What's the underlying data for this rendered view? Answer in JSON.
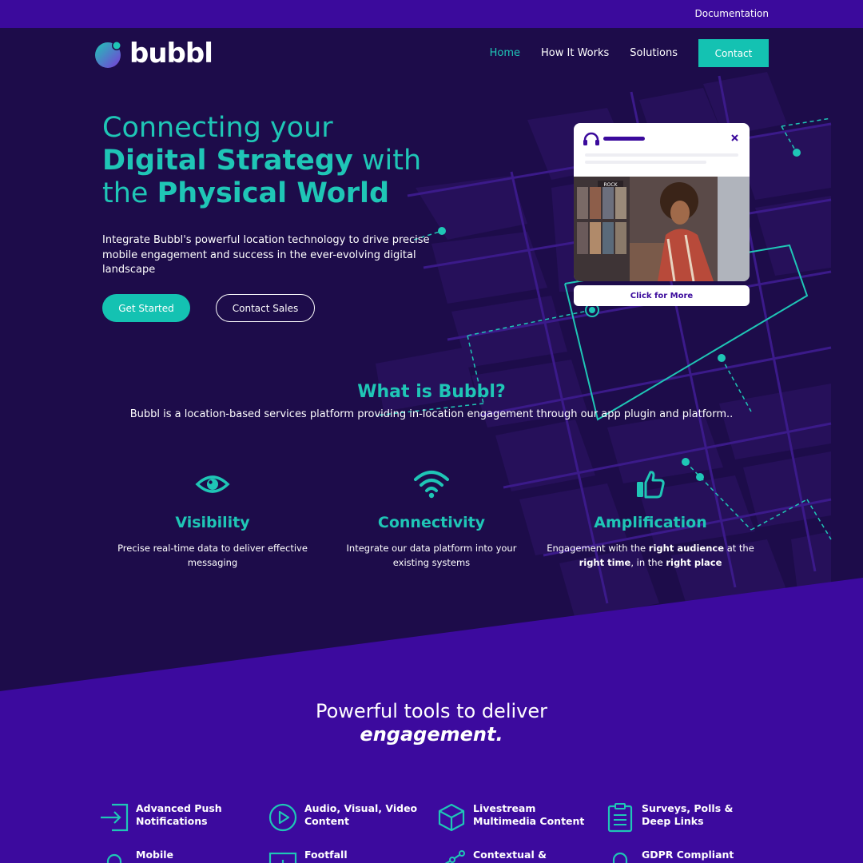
{
  "topbar": {
    "documentation": "Documentation"
  },
  "brand": {
    "name": "bubbl"
  },
  "nav": {
    "home": "Home",
    "how": "How It Works",
    "solutions": "Solutions",
    "contact": "Contact"
  },
  "hero": {
    "line1": "Connecting your",
    "line2_bold": "Digital Strategy",
    "line2_rest": " with",
    "line3_pre": "the ",
    "line3_bold": "Physical World",
    "subcopy": "Integrate Bubbl's powerful location technology to drive precise mobile engagement and success in the ever-evolving digital landscape",
    "primary_cta": "Get Started",
    "secondary_cta": "Contact Sales"
  },
  "card": {
    "cta": "Click for More",
    "shop_sign": "ROCK"
  },
  "what": {
    "title": "What is Bubbl?",
    "text": "Bubbl is a location-based services platform providing in-location engagement through our app plugin and platform.."
  },
  "features": [
    {
      "icon": "eye-icon",
      "title": "Visibility",
      "desc": "Precise real-time data to deliver effective messaging"
    },
    {
      "icon": "wifi-icon",
      "title": "Connectivity",
      "desc": "Integrate our data platform into your existing systems"
    },
    {
      "icon": "thumbs-up-icon",
      "title": "Amplification",
      "desc_pre": "Engagement with the ",
      "desc_b1": "right audience",
      "desc_mid1": " at the ",
      "desc_b2": "right time",
      "desc_mid2": ", in the ",
      "desc_b3": "right place"
    }
  ],
  "tools": {
    "title": "Powerful tools to deliver",
    "title_bold": "engagement.",
    "items": [
      {
        "icon": "login-arrow-icon",
        "label": "Advanced Push Notifications"
      },
      {
        "icon": "play-icon",
        "label": "Audio, Visual, Video Content"
      },
      {
        "icon": "cube-icon",
        "label": "Livestream Multimedia Content"
      },
      {
        "icon": "clipboard-icon",
        "label": "Surveys, Polls & Deep Links"
      },
      {
        "icon": "bell-icon",
        "label": "Mobile"
      },
      {
        "icon": "chart-icon",
        "label": "Footfall"
      },
      {
        "icon": "network-icon",
        "label": "Contextual &"
      },
      {
        "icon": "lock-icon",
        "label": "GDPR Compliant"
      }
    ]
  },
  "colors": {
    "teal": "#1fc6b6",
    "purple": "#3b0a9c",
    "navy": "#1d0c4a"
  }
}
